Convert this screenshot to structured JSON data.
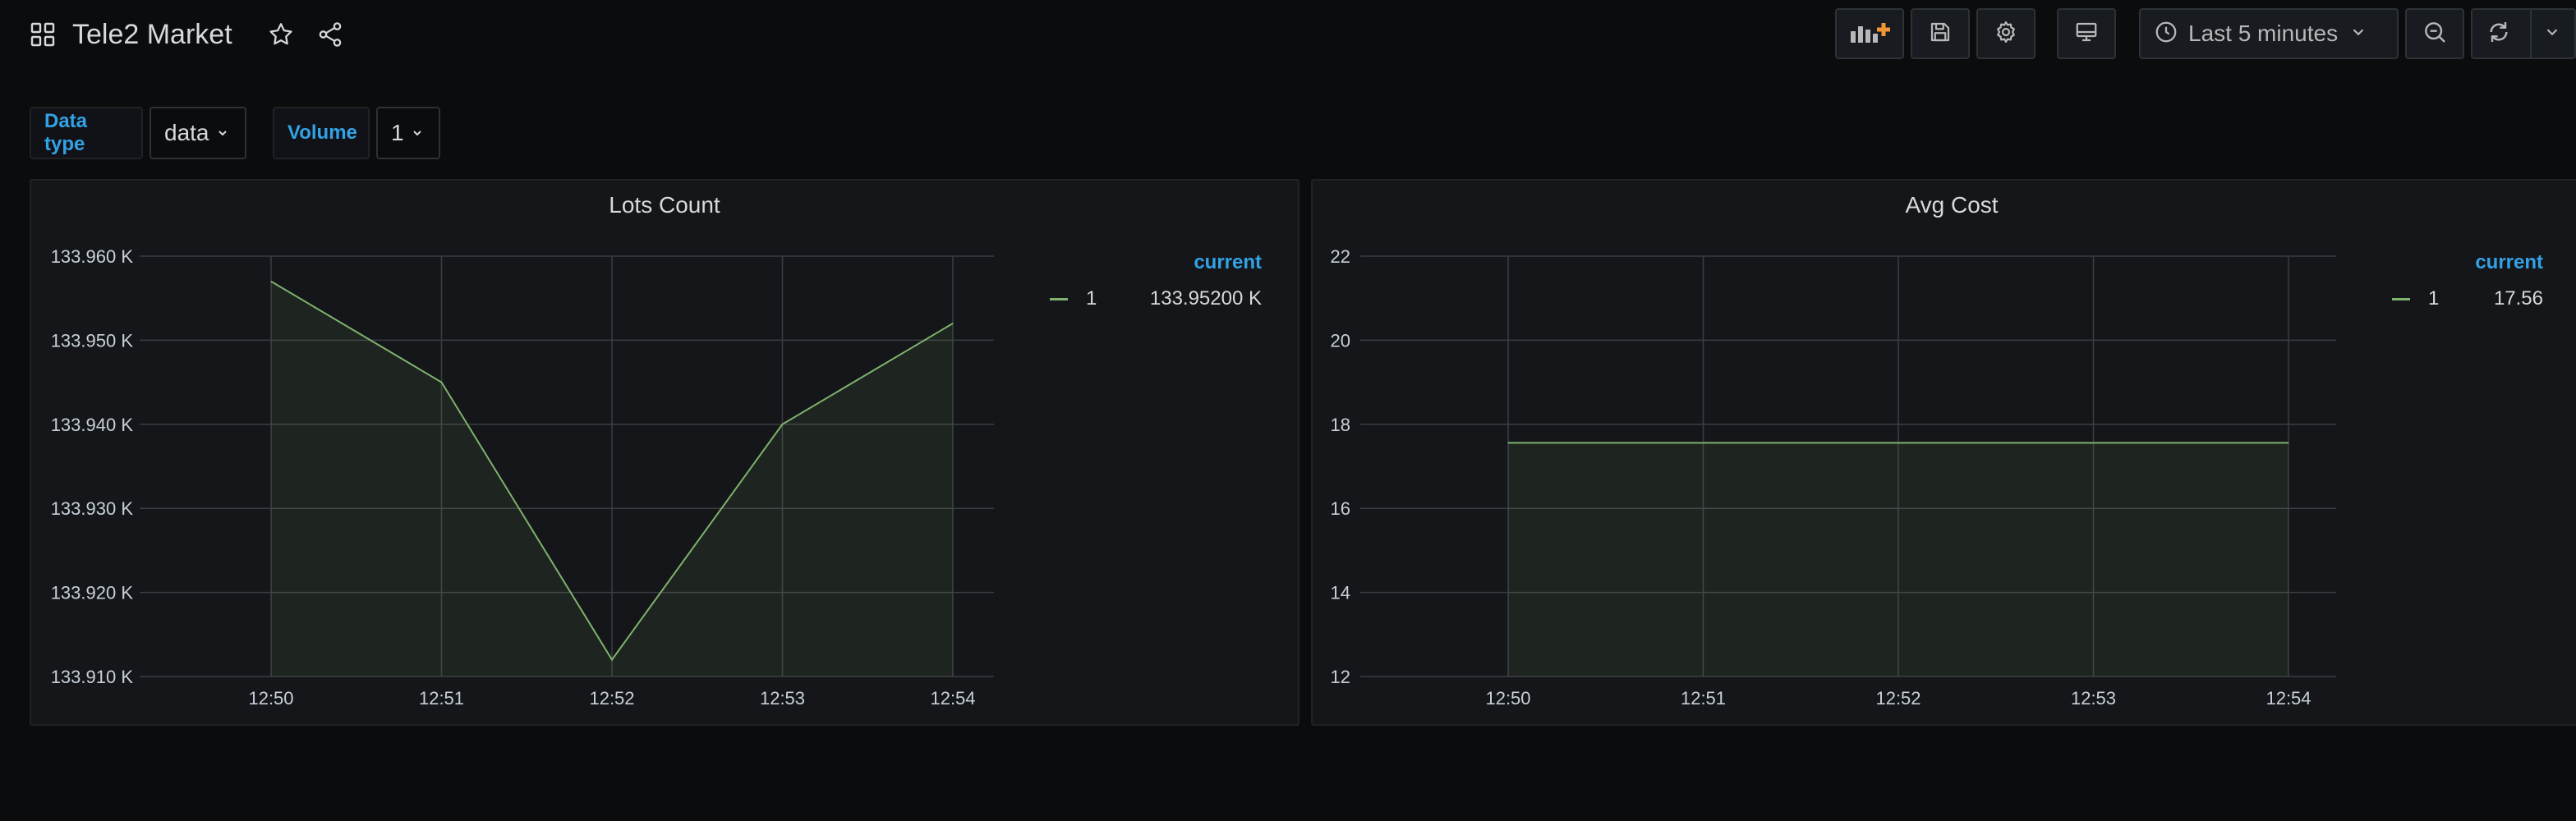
{
  "header": {
    "title": "Tele2 Market",
    "time_range": "Last 5 minutes"
  },
  "icons": [
    "grid-icon",
    "star-icon",
    "share-icon",
    "add-panel-icon",
    "save-icon",
    "gear-icon",
    "tv-icon",
    "clock-icon",
    "chevron-down-icon",
    "zoom-out-icon",
    "refresh-icon"
  ],
  "colors": {
    "accent": "#33a2e5",
    "series": "#7eb26d",
    "add_panel": "#f19636"
  },
  "variables": [
    {
      "label": "Data type",
      "value": "data"
    },
    {
      "label": "Volume",
      "value": "1"
    }
  ],
  "panels": [
    {
      "title": "Lots Count",
      "legend_header": "current",
      "legend": [
        {
          "name": "1",
          "value": "133.95200 K"
        }
      ]
    },
    {
      "title": "Avg Cost",
      "legend_header": "current",
      "legend": [
        {
          "name": "1",
          "value": "17.56"
        }
      ]
    }
  ],
  "chart_data": [
    {
      "type": "area",
      "title": "Lots Count",
      "x": [
        "12:50",
        "12:51",
        "12:52",
        "12:53",
        "12:54"
      ],
      "series": [
        {
          "name": "1",
          "values": [
            133.957,
            133.945,
            133.912,
            133.94,
            133.952
          ]
        }
      ],
      "yticks": [
        "133.910 K",
        "133.920 K",
        "133.930 K",
        "133.940 K",
        "133.950 K",
        "133.960 K"
      ],
      "ylim": [
        133.91,
        133.96
      ],
      "unit": "K",
      "grid": true,
      "legend_position": "right"
    },
    {
      "type": "area",
      "title": "Avg Cost",
      "x": [
        "12:50",
        "12:51",
        "12:52",
        "12:53",
        "12:54"
      ],
      "series": [
        {
          "name": "1",
          "values": [
            17.56,
            17.56,
            17.56,
            17.56,
            17.56
          ]
        }
      ],
      "yticks": [
        "12",
        "14",
        "16",
        "18",
        "20",
        "22"
      ],
      "ylim": [
        12,
        22
      ],
      "grid": true,
      "legend_position": "right"
    }
  ]
}
